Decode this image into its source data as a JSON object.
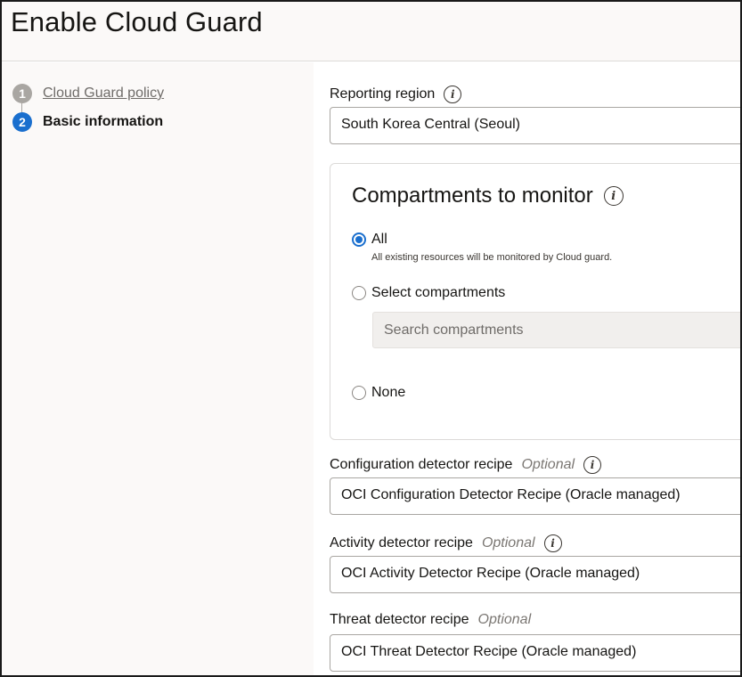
{
  "page": {
    "title": "Enable Cloud Guard"
  },
  "steps": [
    {
      "number": "1",
      "label": "Cloud Guard policy"
    },
    {
      "number": "2",
      "label": "Basic information"
    }
  ],
  "reporting_region": {
    "label": "Reporting region",
    "value": "South Korea Central (Seoul)"
  },
  "compartments": {
    "title": "Compartments to monitor",
    "options": [
      {
        "label": "All",
        "description": "All existing resources will be monitored by Cloud guard.",
        "selected": true
      },
      {
        "label": "Select compartments",
        "selected": false
      },
      {
        "label": "None",
        "selected": false
      }
    ],
    "search_placeholder": "Search compartments"
  },
  "config_recipe": {
    "label": "Configuration detector recipe",
    "optional": "Optional",
    "value": "OCI Configuration Detector Recipe (Oracle managed)"
  },
  "activity_recipe": {
    "label": "Activity detector recipe",
    "optional": "Optional",
    "value": "OCI Activity Detector Recipe (Oracle managed)"
  },
  "threat_recipe": {
    "label": "Threat detector recipe",
    "optional": "Optional",
    "value": "OCI Threat Detector Recipe (Oracle managed)"
  },
  "colors": {
    "accent": "#1a6fce",
    "header_bg": "#fbf9f8",
    "text": "#161513"
  }
}
